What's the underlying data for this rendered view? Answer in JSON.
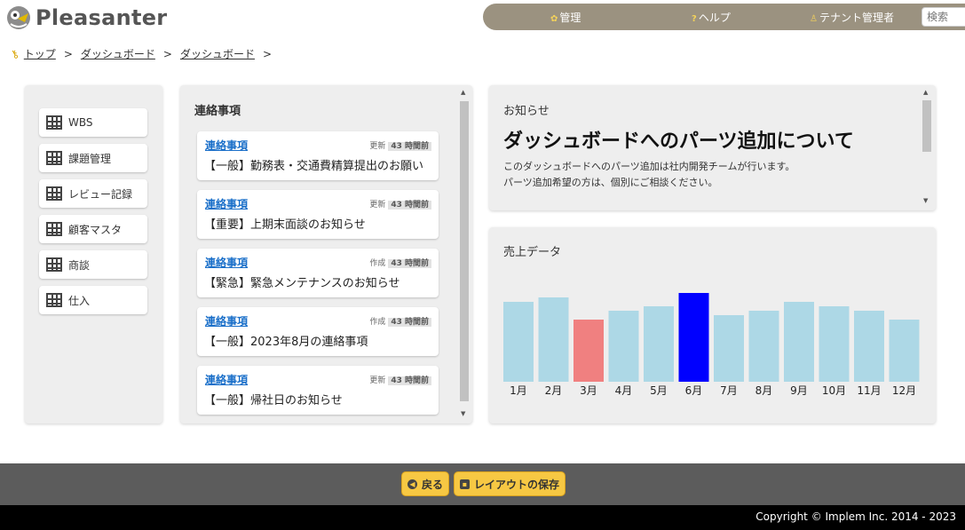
{
  "app": {
    "title": "Pleasanter"
  },
  "topnav": {
    "items": [
      {
        "label": "管理",
        "icon": "gear-icon"
      },
      {
        "label": "ヘルプ",
        "icon": "help-icon"
      },
      {
        "label": "テナント管理者",
        "icon": "user-icon"
      }
    ],
    "search_placeholder": "検索"
  },
  "breadcrumb": [
    "トップ",
    "ダッシュボード",
    "ダッシュボード"
  ],
  "links": [
    "WBS",
    "課題管理",
    "レビュー記録",
    "顧客マスタ",
    "商談",
    "仕入"
  ],
  "notices": {
    "title": "連絡事項",
    "items": [
      {
        "category": "連絡事項",
        "action": "更新",
        "num": "43",
        "unit": "時間前",
        "title": "【一般】勤務表・交通費精算提出のお願い"
      },
      {
        "category": "連絡事項",
        "action": "更新",
        "num": "43",
        "unit": "時間前",
        "title": "【重要】上期末面談のお知らせ"
      },
      {
        "category": "連絡事項",
        "action": "作成",
        "num": "43",
        "unit": "時間前",
        "title": "【緊急】緊急メンテナンスのお知らせ"
      },
      {
        "category": "連絡事項",
        "action": "作成",
        "num": "43",
        "unit": "時間前",
        "title": "【一般】2023年8月の連絡事項"
      },
      {
        "category": "連絡事項",
        "action": "更新",
        "num": "43",
        "unit": "時間前",
        "title": "【一般】帰社日のお知らせ"
      }
    ]
  },
  "announcement": {
    "title": "お知らせ",
    "headline": "ダッシュボードへのパーツ追加について",
    "body1": "このダッシュボードへのパーツ追加は社内開発チームが行います。",
    "body2": "パーツ追加希望の方は、個別にご相談ください。"
  },
  "chart_data": {
    "type": "bar",
    "title": "売上データ",
    "categories": [
      "1月",
      "2月",
      "3月",
      "4月",
      "5月",
      "6月",
      "7月",
      "8月",
      "9月",
      "10月",
      "11月",
      "12月"
    ],
    "values": [
      18,
      19,
      14,
      16,
      17,
      20,
      15,
      16,
      18,
      17,
      16,
      14
    ],
    "colors": [
      "#add8e6",
      "#add8e6",
      "#f08080",
      "#add8e6",
      "#add8e6",
      "#0000ff",
      "#add8e6",
      "#add8e6",
      "#add8e6",
      "#add8e6",
      "#add8e6",
      "#add8e6"
    ],
    "ylim": [
      0,
      20
    ],
    "grid": false,
    "legend": "none"
  },
  "footer": {
    "back_label": "戻る",
    "save_label": "レイアウトの保存",
    "copyright": "Copyright © Implem Inc. 2014 - 2023"
  }
}
